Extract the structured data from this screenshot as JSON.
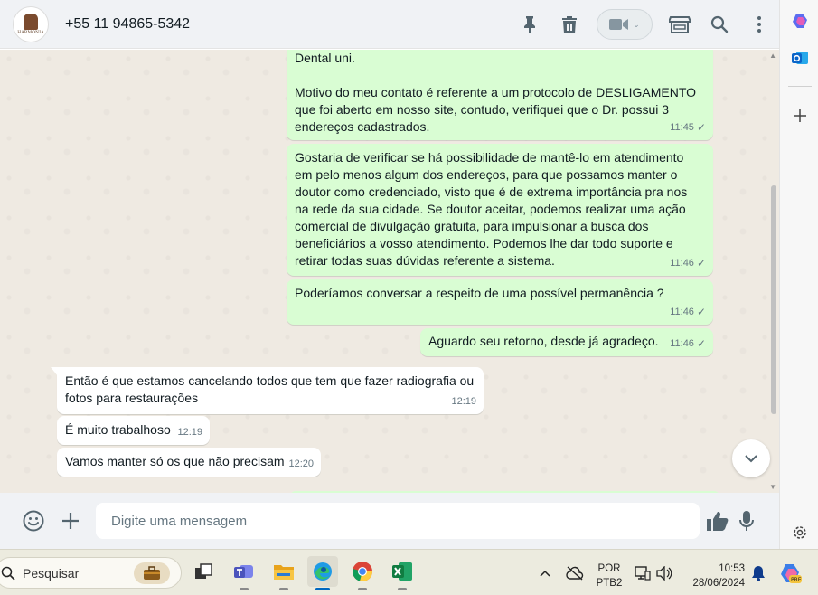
{
  "header": {
    "contact_name": "+55 11 94865-5342",
    "avatar_logo_text": "HARMONIA",
    "actions": [
      "pin-icon",
      "delete-icon",
      "video-call-icon",
      "store-icon",
      "search-icon",
      "menu-icon"
    ]
  },
  "messages": [
    {
      "direction": "out",
      "lines": [
        "Dental uni.",
        "",
        "Motivo do meu contato é referente a um protocolo de DESLIGAMENTO",
        "que foi aberto em nosso site, contudo, verifiquei que o Dr. possui 3",
        "endereços cadastrados."
      ],
      "time": "11:45"
    },
    {
      "direction": "out",
      "lines": [
        "Gostaria de verificar se há possibilidade de mantê-lo em atendimento",
        "em pelo menos algum dos endereços, para que possamos manter o",
        "doutor como credenciado, visto que é de extrema importância pra nos",
        "na rede da sua cidade. Se doutor aceitar, podemos realizar uma ação",
        "comercial de divulgação gratuita, para impulsionar a busca dos",
        "beneficiários a vosso atendimento. Podemos lhe dar todo suporte e",
        "retirar todas suas dúvidas referente a sistema."
      ],
      "time": "11:46"
    },
    {
      "direction": "out",
      "lines": [
        "Poderíamos conversar a respeito de uma possível permanência ?"
      ],
      "time": "11:46"
    },
    {
      "direction": "out",
      "lines": [
        "Aguardo seu retorno, desde já agradeço."
      ],
      "time": "11:46"
    },
    {
      "direction": "in",
      "lines": [
        "Então é que estamos cancelando todos que tem que fazer radiografia ou",
        "fotos para restaurações"
      ],
      "time": "12:19"
    },
    {
      "direction": "in",
      "lines": [
        "É muito trabalhoso"
      ],
      "time": "12:19"
    },
    {
      "direction": "in",
      "lines": [
        "Vamos manter só os que não precisam"
      ],
      "time": "12:20"
    }
  ],
  "composer": {
    "placeholder": "Digite uma mensagem"
  },
  "taskbar": {
    "search_label": "Pesquisar",
    "language_line1": "POR",
    "language_line2": "PTB2",
    "time": "10:53",
    "date": "28/06/2024"
  },
  "colors": {
    "outgoing_bubble": "#d9fdd3",
    "incoming_bubble": "#ffffff",
    "chat_background": "#efeae2",
    "header_background": "#f0f2f5"
  }
}
